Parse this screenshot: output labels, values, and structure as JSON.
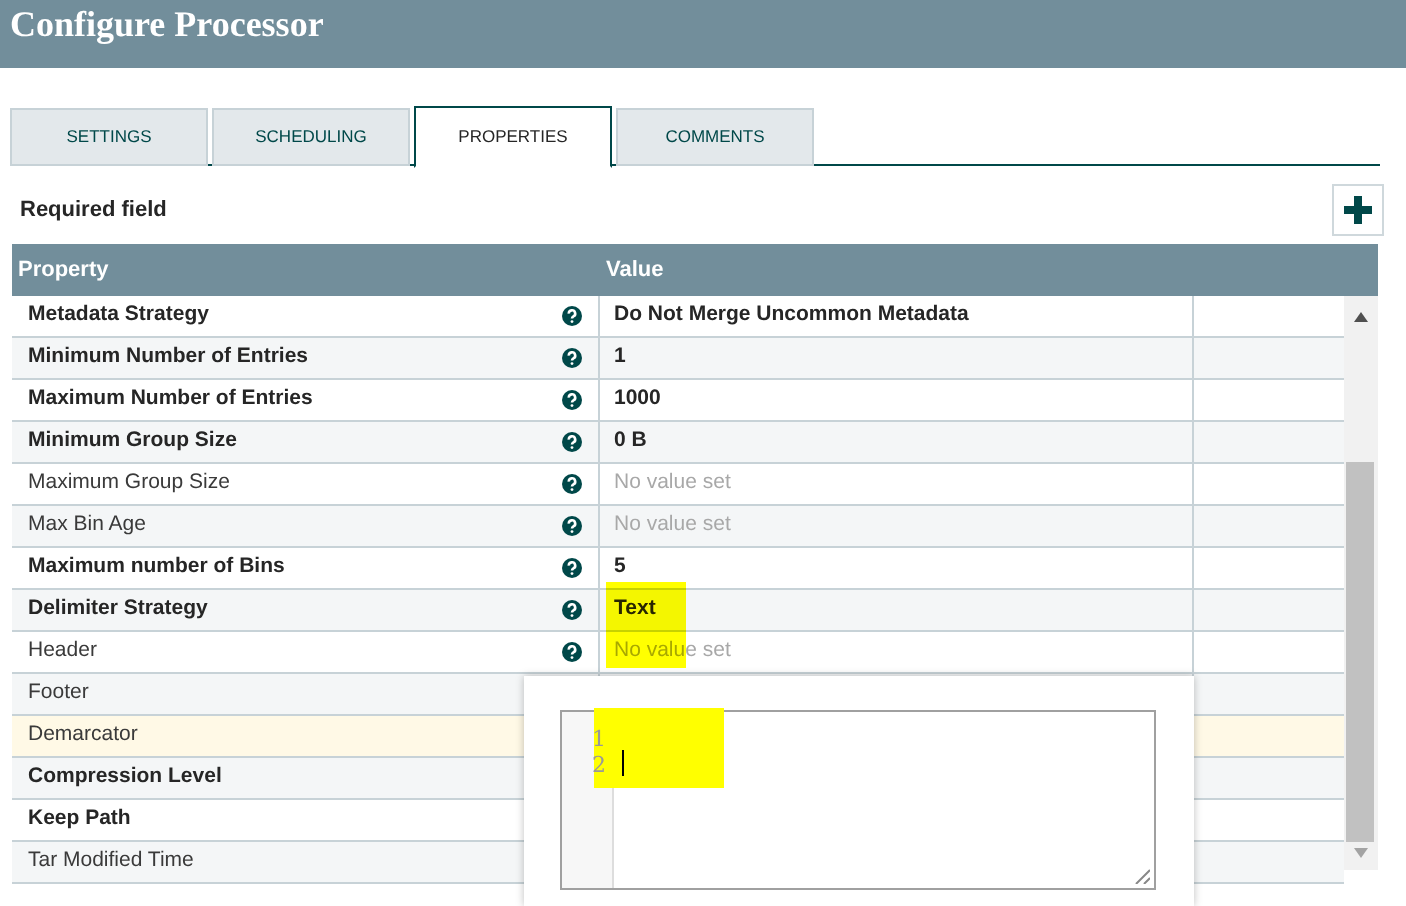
{
  "window": {
    "title": "Configure Processor"
  },
  "tabs": [
    {
      "label": "SETTINGS",
      "selected": false
    },
    {
      "label": "SCHEDULING",
      "selected": false
    },
    {
      "label": "PROPERTIES",
      "selected": true
    },
    {
      "label": "COMMENTS",
      "selected": false
    }
  ],
  "legend": "Required field",
  "table": {
    "columns": [
      "Property",
      "Value"
    ],
    "rows": [
      {
        "name": "Metadata Strategy",
        "required": true,
        "help": true,
        "value": "Do Not Merge Uncommon Metadata",
        "value_set": true,
        "selected": false
      },
      {
        "name": "Minimum Number of Entries",
        "required": true,
        "help": true,
        "value": "1",
        "value_set": true,
        "selected": false
      },
      {
        "name": "Maximum Number of Entries",
        "required": true,
        "help": true,
        "value": "1000",
        "value_set": true,
        "selected": false
      },
      {
        "name": "Minimum Group Size",
        "required": true,
        "help": true,
        "value": "0 B",
        "value_set": true,
        "selected": false
      },
      {
        "name": "Maximum Group Size",
        "required": false,
        "help": true,
        "value": "No value set",
        "value_set": false,
        "selected": false
      },
      {
        "name": "Max Bin Age",
        "required": false,
        "help": true,
        "value": "No value set",
        "value_set": false,
        "selected": false
      },
      {
        "name": "Maximum number of Bins",
        "required": true,
        "help": true,
        "value": "5",
        "value_set": true,
        "selected": false
      },
      {
        "name": "Delimiter Strategy",
        "required": true,
        "help": true,
        "value": "Text",
        "value_set": true,
        "selected": false,
        "highlighted": true
      },
      {
        "name": "Header",
        "required": false,
        "help": true,
        "value": "No value set",
        "value_set": false,
        "selected": false
      },
      {
        "name": "Footer",
        "required": false,
        "selected": false
      },
      {
        "name": "Demarcator",
        "required": false,
        "selected": true
      },
      {
        "name": "Compression Level",
        "required": true,
        "selected": false
      },
      {
        "name": "Keep Path",
        "required": true,
        "selected": false
      },
      {
        "name": "Tar Modified Time",
        "required": false,
        "selected": false
      }
    ]
  },
  "editor": {
    "line_numbers": [
      "1",
      "2"
    ],
    "highlighted": true
  }
}
